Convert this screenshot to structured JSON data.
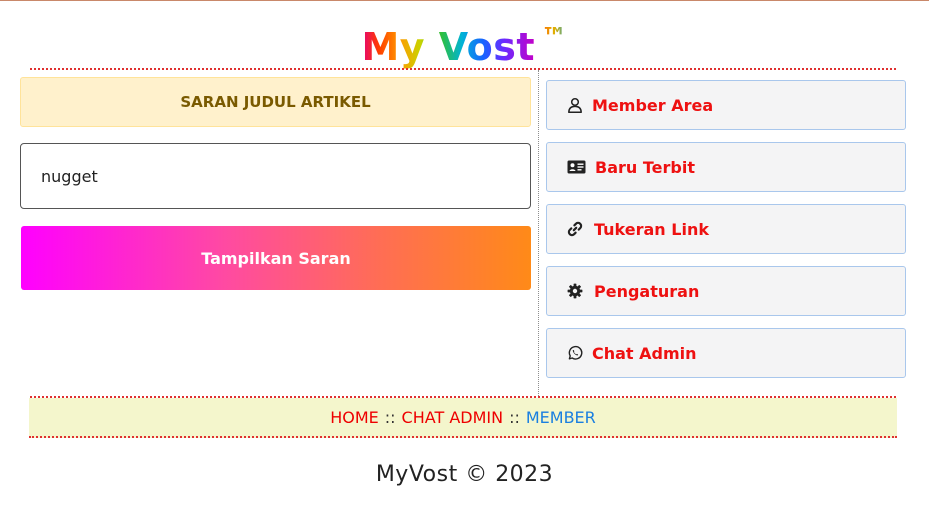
{
  "header": {
    "title": "My Vost",
    "trademark": "™"
  },
  "left_panel": {
    "notice": "SARAN JUDUL ARTIKEL",
    "keyword_input": {
      "value": "nugget",
      "placeholder": ""
    },
    "submit_label": "Tampilkan Saran"
  },
  "menu": {
    "items": [
      {
        "label": "Member Area",
        "icon": "user-icon"
      },
      {
        "label": "Baru Terbit",
        "icon": "id-card-icon"
      },
      {
        "label": "Tukeran Link",
        "icon": "link-icon"
      },
      {
        "label": "Pengaturan",
        "icon": "gear-icon"
      },
      {
        "label": "Chat Admin",
        "icon": "whatsapp-icon"
      }
    ]
  },
  "breadcrumb": {
    "home": "HOME",
    "separator": "::",
    "chat_admin": "CHAT ADMIN",
    "member": "MEMBER"
  },
  "footer": {
    "text": "MyVost © 2023"
  },
  "colors": {
    "menu_label": "#ee1111",
    "menu_bg": "#f4f4f5",
    "notice_bg": "#fff1cc",
    "breadcrumb_bg": "#f4f6cc",
    "breadcrumb_active": "#1a7fe0"
  }
}
